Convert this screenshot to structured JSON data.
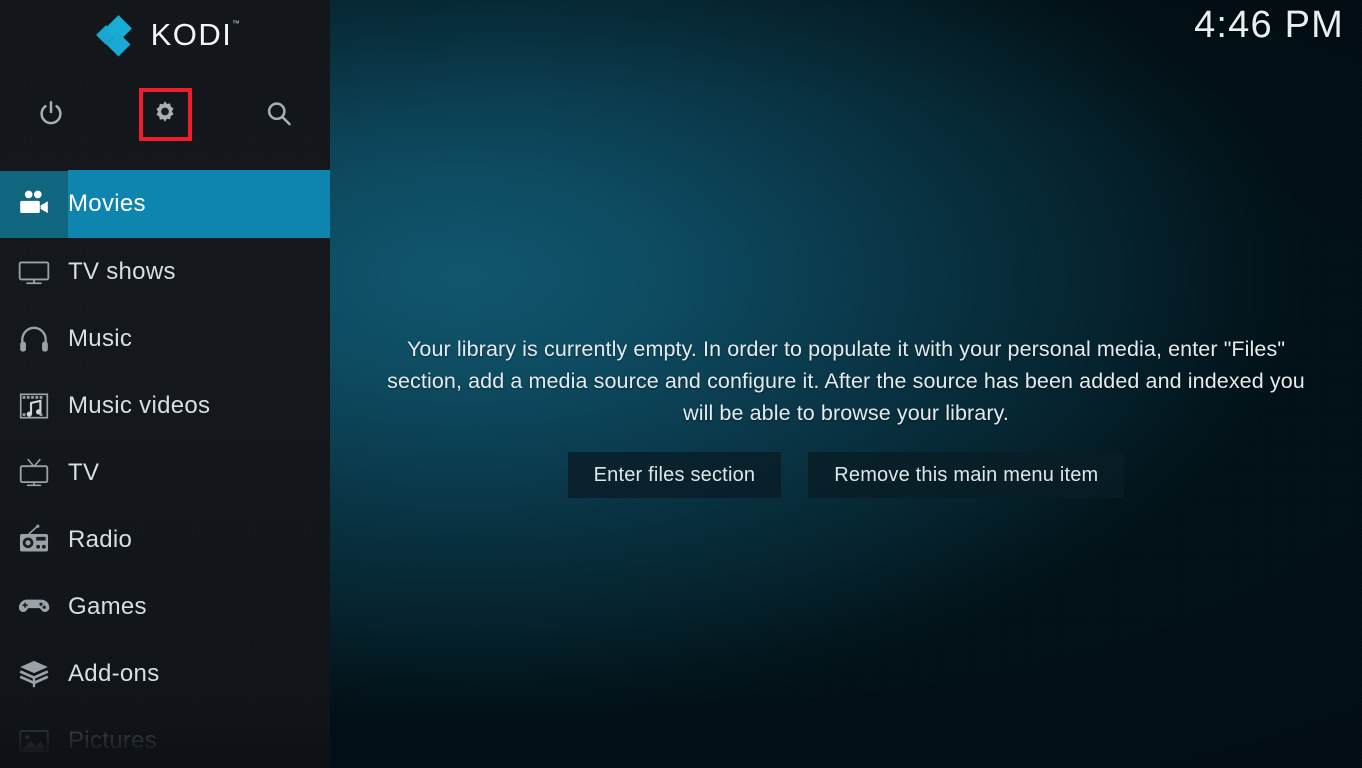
{
  "app": {
    "name": "KODI",
    "trademark": "™"
  },
  "header": {
    "clock": "4:46 PM",
    "actions": [
      {
        "name": "power-button",
        "icon": "power-icon",
        "label": "Power"
      },
      {
        "name": "settings-button",
        "icon": "gear-icon",
        "label": "Settings",
        "focused": true
      },
      {
        "name": "search-button",
        "icon": "search-icon",
        "label": "Search"
      }
    ]
  },
  "sidebar": {
    "items": [
      {
        "label": "Movies",
        "icon": "movie-camera-icon",
        "selected": true,
        "faded": false
      },
      {
        "label": "TV shows",
        "icon": "television-icon",
        "selected": false,
        "faded": false
      },
      {
        "label": "Music",
        "icon": "headphones-icon",
        "selected": false,
        "faded": false
      },
      {
        "label": "Music videos",
        "icon": "film-music-icon",
        "selected": false,
        "faded": false
      },
      {
        "label": "TV",
        "icon": "tv-antenna-icon",
        "selected": false,
        "faded": false
      },
      {
        "label": "Radio",
        "icon": "radio-icon",
        "selected": false,
        "faded": false
      },
      {
        "label": "Games",
        "icon": "gamepad-icon",
        "selected": false,
        "faded": false
      },
      {
        "label": "Add-ons",
        "icon": "open-box-icon",
        "selected": false,
        "faded": false
      },
      {
        "label": "Pictures",
        "icon": "picture-icon",
        "selected": false,
        "faded": true
      }
    ]
  },
  "main": {
    "empty_message": "Your library is currently empty. In order to populate it with your personal media, enter \"Files\" section, add a media source and configure it. After the source has been added and indexed you will be able to browse your library.",
    "buttons": [
      {
        "label": "Enter files section"
      },
      {
        "label": "Remove this main menu item"
      }
    ]
  },
  "colors": {
    "accent": "#0d85ae",
    "accent_dark": "#10657f",
    "logo_blue": "#17aed6",
    "focus_outline": "#f01d2d",
    "sidebar_bg": "#14181c",
    "background_teal": "#10566e"
  }
}
